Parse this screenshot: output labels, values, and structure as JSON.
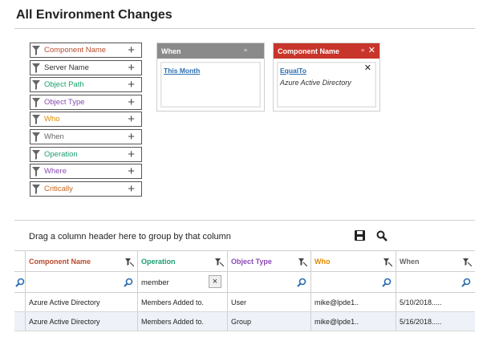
{
  "page": {
    "title": "All Environment Changes"
  },
  "colors": {
    "component": "#b94a2c",
    "operation": "#1a9e6e",
    "object_path": "#1aa36a",
    "object_type": "#8a4bb4",
    "who": "#e08a00",
    "when": "#666666",
    "where": "#8a4bb4",
    "critically": "#c9631a",
    "server": "#333333",
    "when_card_header": "#8a8a8a",
    "component_card_header": "#c8352b"
  },
  "filters": [
    {
      "label": "Component Name",
      "color": "#b94a2c"
    },
    {
      "label": "Server Name",
      "color": "#333333"
    },
    {
      "label": "Object Path",
      "color": "#1aa36a"
    },
    {
      "label": "Object Type",
      "color": "#8a4bb4"
    },
    {
      "label": "Who",
      "color": "#e08a00"
    },
    {
      "label": "When",
      "color": "#666666"
    },
    {
      "label": "Operation",
      "color": "#1a9e6e"
    },
    {
      "label": "Where",
      "color": "#8a4bb4"
    },
    {
      "label": "Critically",
      "color": "#c9631a"
    }
  ],
  "cards": {
    "when": {
      "title": "When",
      "link": "This Month"
    },
    "component": {
      "title": "Component Name",
      "link": "EqualTo",
      "value": "Azure Active Directory"
    }
  },
  "grid": {
    "group_text": "Drag a column header here to group by that column",
    "columns": [
      {
        "label": "Component Name",
        "color": "#b94a2c"
      },
      {
        "label": "Operation",
        "color": "#1a9e6e"
      },
      {
        "label": "Object Type",
        "color": "#8a4bb4"
      },
      {
        "label": "Who",
        "color": "#e08a00"
      },
      {
        "label": "When",
        "color": "#666666"
      }
    ],
    "filter_row": {
      "operation_value": "member",
      "clear_label": "×"
    },
    "rows": [
      [
        "Azure Active Directory",
        "Members Added to.",
        "User",
        "mike@lpde1..",
        "5/10/2018....."
      ],
      [
        "Azure Active Directory",
        "Members Added to.",
        "Group",
        "mike@lpde1..",
        "5/16/2018....."
      ]
    ]
  }
}
